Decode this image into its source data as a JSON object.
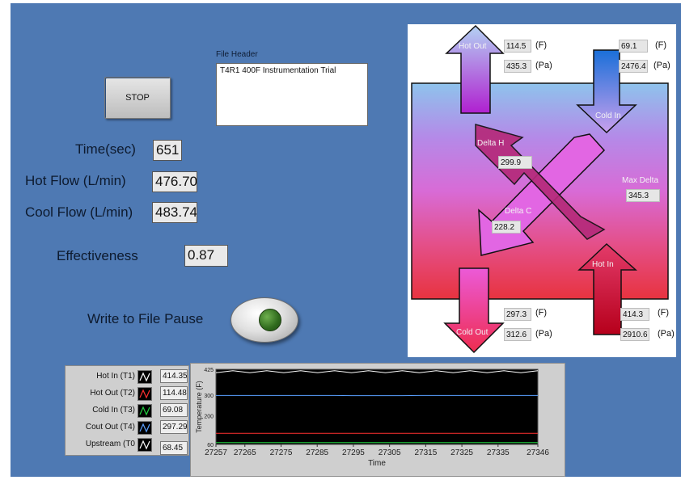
{
  "stop_button": {
    "label": "STOP"
  },
  "file_header": {
    "label": "File Header",
    "value": "T4R1 400F Instrumentation Trial"
  },
  "indicators": {
    "time": {
      "label": "Time(sec)",
      "value": "651"
    },
    "hot_flow": {
      "label": "Hot Flow (L/min)",
      "value": "476.70"
    },
    "cool_flow": {
      "label": "Cool Flow (L/min)",
      "value": "483.74"
    },
    "effectiveness": {
      "label": "Effectiveness",
      "value": "0.87"
    }
  },
  "write_pause": {
    "label": "Write to File Pause"
  },
  "diagram": {
    "hot_out": {
      "label": "Hot Out",
      "temp": "114.5",
      "pressure": "435.3"
    },
    "cold_in": {
      "label": "Cold In",
      "temp": "69.1",
      "pressure": "2476.4"
    },
    "cold_out": {
      "label": "Cold Out",
      "temp": "297.3",
      "pressure": "312.6"
    },
    "hot_in": {
      "label": "Hot In",
      "temp": "414.3",
      "pressure": "2910.6"
    },
    "delta_h": {
      "label": "Delta H",
      "value": "299.9"
    },
    "delta_c": {
      "label": "Delta C",
      "value": "228.2"
    },
    "max_delta": {
      "label": "Max Delta",
      "value": "345.3"
    },
    "unit_f": "(F)",
    "unit_pa": "(Pa)"
  },
  "legend": [
    {
      "name": "Hot In (T1)",
      "value": "414.35",
      "color": "#ffffff"
    },
    {
      "name": "Hot Out (T2)",
      "value": "114.48",
      "color": "#ff3030"
    },
    {
      "name": "Cold In (T3)",
      "value": "69.08",
      "color": "#20d040"
    },
    {
      "name": "Cout Out (T4)",
      "value": "297.29",
      "color": "#5aa0ff"
    },
    {
      "name": "Upstream (T0",
      "value": "68.45",
      "color": "#ffffff"
    }
  ],
  "chart_data": {
    "type": "line",
    "ylabel": "Temperature (F)",
    "xlabel": "Time",
    "ylim": [
      60,
      425
    ],
    "xlim": [
      27257,
      27346
    ],
    "y_ticks": [
      "425",
      "300",
      "200",
      "60"
    ],
    "x_ticks": [
      "27257",
      "27265",
      "27275",
      "27285",
      "27295",
      "27305",
      "27315",
      "27325",
      "27335",
      "27346"
    ],
    "series": [
      {
        "name": "Hot In (T1)",
        "color": "#ffffff",
        "values": [
          408,
          418,
          408,
          418,
          408,
          418,
          408,
          418,
          408,
          418,
          408,
          418,
          408,
          418,
          408,
          418,
          408,
          418,
          408,
          418
        ]
      },
      {
        "name": "Cout Out (T4)",
        "color": "#5aa0ff",
        "values": [
          298,
          298,
          298,
          298,
          298,
          298,
          298,
          298,
          297,
          297,
          297,
          297,
          298,
          298,
          298,
          298,
          298,
          298,
          298,
          298
        ]
      },
      {
        "name": "Hot Out (T2)",
        "color": "#ff3030",
        "values": [
          114,
          114,
          114,
          114,
          114,
          114,
          114,
          114,
          114,
          114,
          114,
          114,
          114,
          114,
          114,
          114,
          114,
          114,
          114,
          114
        ]
      },
      {
        "name": "Cold In (T3)",
        "color": "#20d040",
        "values": [
          69,
          69,
          69,
          69,
          69,
          69,
          69,
          69,
          69,
          69,
          69,
          69,
          69,
          69,
          69,
          69,
          69,
          69,
          69,
          69
        ]
      }
    ]
  }
}
